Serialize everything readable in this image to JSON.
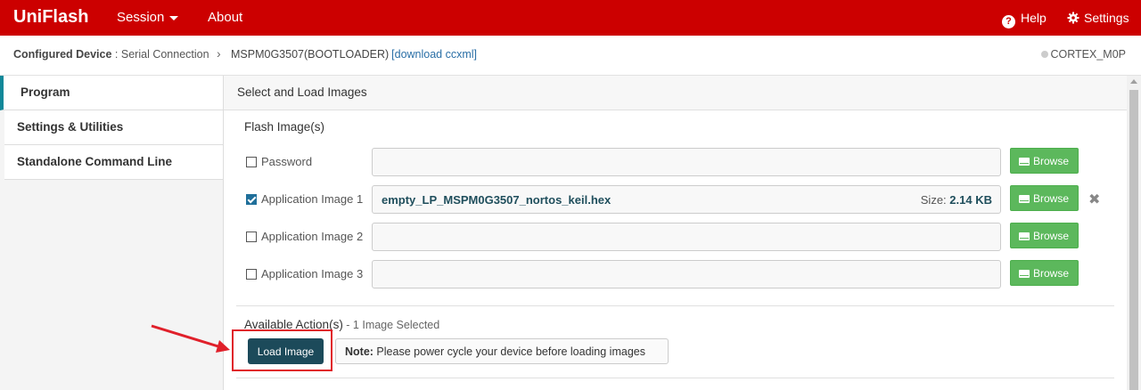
{
  "topbar": {
    "brand": "UniFlash",
    "session_label": "Session",
    "about_label": "About",
    "help_label": "Help",
    "settings_label": "Settings"
  },
  "breadcrumb": {
    "label": "Configured Device",
    "separator": ":",
    "connection": "Serial Connection",
    "chevron": "›",
    "device": "MSPM0G3507(BOOTLOADER)",
    "link": "[download ccxml]",
    "core": "CORTEX_M0P"
  },
  "sidebar": {
    "items": [
      {
        "label": "Program",
        "active": true
      },
      {
        "label": "Settings & Utilities",
        "active": false
      },
      {
        "label": "Standalone Command Line",
        "active": false
      }
    ]
  },
  "main": {
    "header": "Select and Load Images",
    "flash_title": "Flash Image(s)",
    "rows": [
      {
        "label": "Password",
        "checked": false,
        "file": "",
        "size_label": "",
        "size": ""
      },
      {
        "label": "Application Image 1",
        "checked": true,
        "file": "empty_LP_MSPM0G3507_nortos_keil.hex",
        "size_label": "Size:",
        "size": "2.14 KB"
      },
      {
        "label": "Application Image 2",
        "checked": false,
        "file": "",
        "size_label": "",
        "size": ""
      },
      {
        "label": "Application Image 3",
        "checked": false,
        "file": "",
        "size_label": "",
        "size": ""
      }
    ],
    "browse_label": "Browse",
    "remove_glyph": "✖",
    "actions_title": "Available Action(s)",
    "actions_sub": " - 1 Image Selected",
    "load_button": "Load Image",
    "note_label": "Note:",
    "note_text": " Please power cycle your device before loading images"
  },
  "colors": {
    "brand_red": "#cc0000",
    "accent_teal": "#118899",
    "browse_green": "#5cb85c",
    "load_button": "#1c4a5a",
    "highlight_red": "#e0202a"
  }
}
